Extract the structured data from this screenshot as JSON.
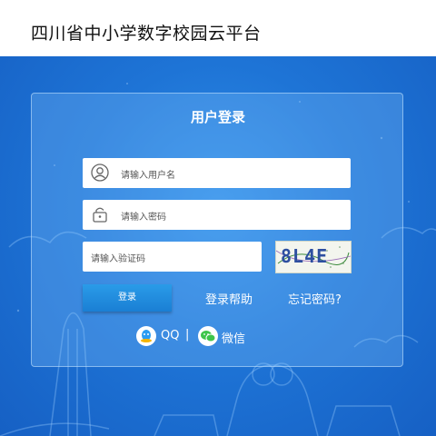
{
  "header": {
    "title": "四川省中小学数字校园云平台"
  },
  "login": {
    "title": "用户登录",
    "username_placeholder": "请输入用户名",
    "password_placeholder": "请输入密码",
    "captcha_placeholder": "请输入验证码",
    "captcha_text": "8L4E",
    "login_button": "登录",
    "help_link": "登录帮助",
    "forgot_link": "忘记密码?"
  },
  "social": {
    "qq_label": "QQ",
    "separator": "|",
    "wechat_label": "微信"
  },
  "colors": {
    "background": "#1e74d6",
    "login_button": "#1a7fd4",
    "qq": "#2b9cf2",
    "wechat": "#3ec54a"
  }
}
